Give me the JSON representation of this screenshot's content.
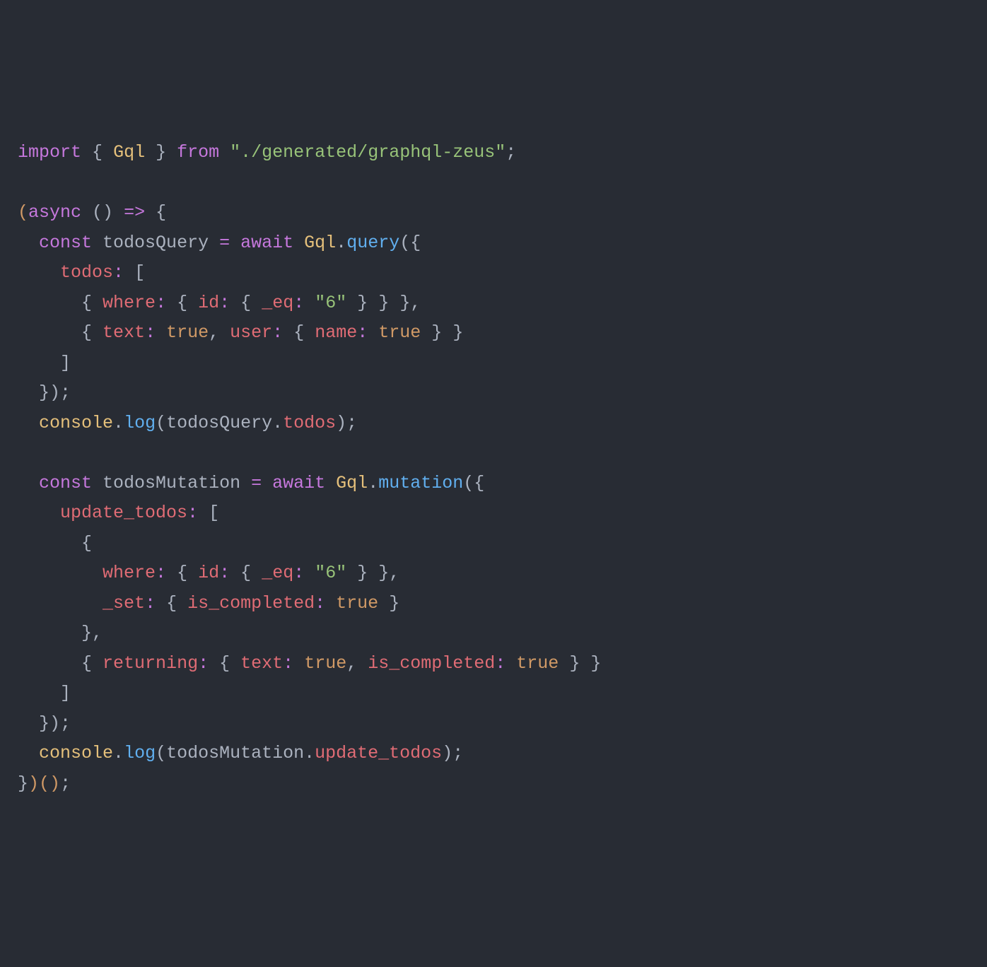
{
  "lines": {
    "l1_import": "import",
    "l1_brace_open": "{",
    "l1_gql": "Gql",
    "l1_brace_close": "}",
    "l1_from": "from",
    "l1_string": "\"./generated/graphql-zeus\"",
    "l1_semi": ";",
    "l3_paren": "(",
    "l3_async": "async",
    "l3_parens": "()",
    "l3_arrow": "=>",
    "l3_brace": "{",
    "l4_const": "const",
    "l4_var": "todosQuery",
    "l4_eq": "=",
    "l4_await": "await",
    "l4_gql": "Gql",
    "l4_dot": ".",
    "l4_query": "query",
    "l4_paren": "(",
    "l4_brace": "{",
    "l5_todos": "todos",
    "l5_colon": ":",
    "l5_bracket": "[",
    "l6_brace1": "{",
    "l6_where": "where",
    "l6_colon1": ":",
    "l6_brace2": "{",
    "l6_id": "id",
    "l6_colon2": ":",
    "l6_brace3": "{",
    "l6_eq_key": "_eq",
    "l6_colon3": ":",
    "l6_six": "\"6\"",
    "l6_brace_close3": "}",
    "l6_brace_close2": "}",
    "l6_brace_close1": "}",
    "l6_comma": ",",
    "l7_brace1": "{",
    "l7_text": "text",
    "l7_colon1": ":",
    "l7_true1": "true",
    "l7_comma1": ",",
    "l7_user": "user",
    "l7_colon2": ":",
    "l7_brace2": "{",
    "l7_name": "name",
    "l7_colon3": ":",
    "l7_true2": "true",
    "l7_brace_close2": "}",
    "l7_brace_close1": "}",
    "l8_bracket": "]",
    "l9_brace": "}",
    "l9_paren": ")",
    "l9_semi": ";",
    "l10_console": "console",
    "l10_dot": ".",
    "l10_log": "log",
    "l10_paren_open": "(",
    "l10_var": "todosQuery",
    "l10_dot2": ".",
    "l10_todos": "todos",
    "l10_paren_close": ")",
    "l10_semi": ";",
    "l12_const": "const",
    "l12_var": "todosMutation",
    "l12_eq": "=",
    "l12_await": "await",
    "l12_gql": "Gql",
    "l12_dot": ".",
    "l12_mutation": "mutation",
    "l12_paren": "(",
    "l12_brace": "{",
    "l13_update": "update_todos",
    "l13_colon": ":",
    "l13_bracket": "[",
    "l14_brace": "{",
    "l15_where": "where",
    "l15_colon1": ":",
    "l15_brace1": "{",
    "l15_id": "id",
    "l15_colon2": ":",
    "l15_brace2": "{",
    "l15_eq": "_eq",
    "l15_colon3": ":",
    "l15_six": "\"6\"",
    "l15_brace_close2": "}",
    "l15_brace_close1": "}",
    "l15_comma": ",",
    "l16_set": "_set",
    "l16_colon1": ":",
    "l16_brace1": "{",
    "l16_is_completed": "is_completed",
    "l16_colon2": ":",
    "l16_true": "true",
    "l16_brace_close1": "}",
    "l17_brace": "}",
    "l17_comma": ",",
    "l18_brace1": "{",
    "l18_returning": "returning",
    "l18_colon1": ":",
    "l18_brace2": "{",
    "l18_text": "text",
    "l18_colon2": ":",
    "l18_true1": "true",
    "l18_comma1": ",",
    "l18_is_completed": "is_completed",
    "l18_colon3": ":",
    "l18_true2": "true",
    "l18_brace_close2": "}",
    "l18_brace_close1": "}",
    "l19_bracket": "]",
    "l20_brace": "}",
    "l20_paren": ")",
    "l20_semi": ";",
    "l21_console": "console",
    "l21_dot": ".",
    "l21_log": "log",
    "l21_paren_open": "(",
    "l21_var": "todosMutation",
    "l21_dot2": ".",
    "l21_update": "update_todos",
    "l21_paren_close": ")",
    "l21_semi": ";",
    "l22_brace": "}",
    "l22_paren1": ")",
    "l22_paren2": "(",
    "l22_paren3": ")",
    "l22_semi": ";"
  }
}
